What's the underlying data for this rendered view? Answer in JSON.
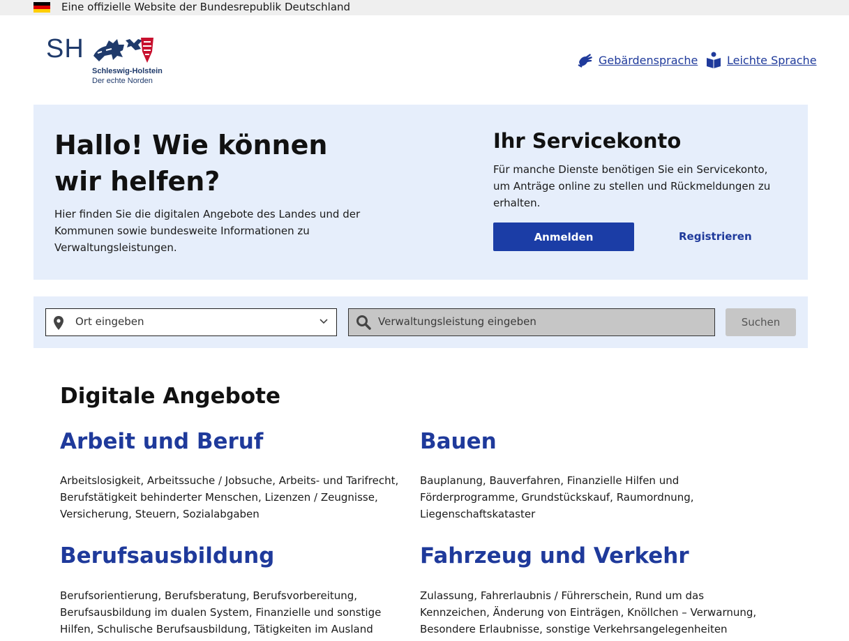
{
  "topbar": {
    "text": "Eine offizielle Website der Bundesrepublik Deutschland",
    "flag_colors": [
      "#000000",
      "#dd0000",
      "#ffce00"
    ]
  },
  "logo": {
    "short": "SH",
    "name": "Schleswig-Holstein",
    "tagline": "Der echte Norden"
  },
  "header_links": [
    {
      "label": "Gebärdensprache",
      "icon": "sign-language-icon"
    },
    {
      "label": "Leichte Sprache",
      "icon": "easy-language-icon"
    }
  ],
  "hero": {
    "title": "Hallo! Wie können wir helfen?",
    "text": "Hier finden Sie die digitalen Angebote des Landes und der Kommunen sowie bundesweite Informationen zu Verwaltungsleistungen."
  },
  "servicekonto": {
    "title": "Ihr Servicekonto",
    "text": "Für manche Dienste benötigen Sie ein Servicekonto, um Anträge online zu stellen und Rückmeldungen zu erhalten.",
    "login_label": "Anmelden",
    "register_label": "Registrieren"
  },
  "search": {
    "location_placeholder": "Ort eingeben",
    "service_placeholder": "Verwaltungsleistung eingeben",
    "button_label": "Suchen"
  },
  "digital": {
    "title": "Digitale Angebote",
    "categories": [
      {
        "title": "Arbeit und Beruf",
        "text": "Arbeitslosigkeit, Arbeitssuche / Jobsuche, Arbeits- und Tarifrecht, Berufstätigkeit behinderter Menschen, Lizenzen / Zeugnisse, Versicherung, Steuern, Sozialabgaben"
      },
      {
        "title": "Bauen",
        "text": "Bauplanung, Bauverfahren, Finanzielle Hilfen und Förderprogramme, Grundstückskauf, Raumordnung, Liegenschaftskataster"
      },
      {
        "title": "Berufsausbildung",
        "text": "Berufsorientierung, Berufsberatung, Berufsvorbereitung, Berufsausbildung im dualen System, Finanzielle und sonstige Hilfen, Schulische Berufsausbildung, Tätigkeiten im Ausland"
      },
      {
        "title": "Fahrzeug und Verkehr",
        "text": "Zulassung, Fahrerlaubnis / Führerschein, Rund um das Kennzeichen, Änderung von Einträgen, Knöllchen – Verwarnung, Besondere Erlaubnisse, sonstige Verkehrsangelegenheiten"
      }
    ]
  },
  "colors": {
    "brand_blue": "#1b3da6",
    "link_blue": "#1f3a9b",
    "panel_bg": "#e6eefb"
  }
}
